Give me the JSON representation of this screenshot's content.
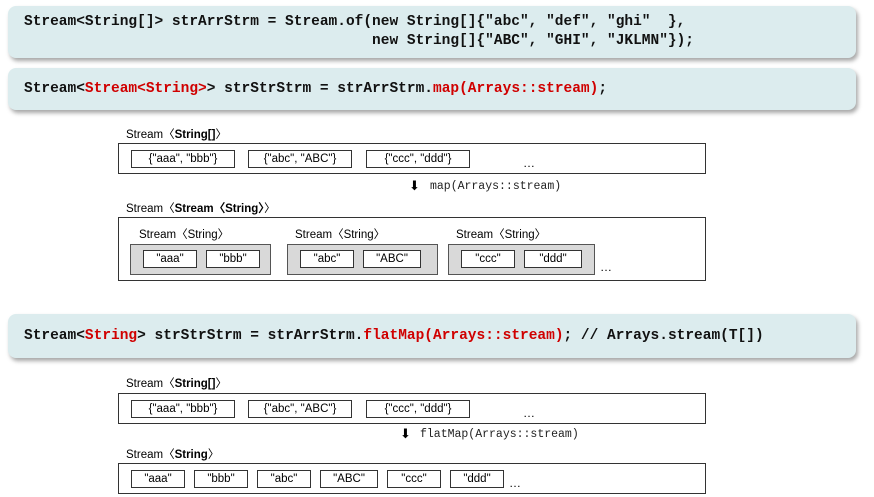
{
  "code1": {
    "line1": "Stream<String[]> strArrStrm = Stream.of(new String[]{\"abc\", \"def\", \"ghi\"  },",
    "line2": "                                        new String[]{\"ABC\", \"GHI\", \"JKLMN\"});"
  },
  "code2": {
    "prefix": "Stream<",
    "t1": "Stream<String>",
    "mid": "> strStrStrm = strArrStrm.",
    "call": "map(Arrays::stream)",
    "end": ";"
  },
  "code3": {
    "prefix": "Stream<",
    "t1": "String",
    "mid": "> strStrStrm = strArrStrm.",
    "call": "flatMap(Arrays::stream)",
    "end": "; // Arrays.stream(T[])"
  },
  "diagram1": {
    "top_label_prefix": "Stream",
    "top_label_type": "String[]",
    "arrays": [
      "{\"aaa\", \"bbb\"}",
      "{\"abc\", \"ABC\"}",
      "{\"ccc\", \"ddd\"}"
    ],
    "ellipsis": "…",
    "operation": "map(Arrays::stream)",
    "bottom_label_prefix": "Stream",
    "bottom_label_type": "Stream",
    "bottom_label_inner": "String",
    "groups": [
      {
        "label": "Stream〈String〉",
        "items": [
          "\"aaa\"",
          "\"bbb\""
        ]
      },
      {
        "label": "Stream〈String〉",
        "items": [
          "\"abc\"",
          "\"ABC\""
        ]
      },
      {
        "label": "Stream〈String〉",
        "items": [
          "\"ccc\"",
          "\"ddd\""
        ]
      }
    ]
  },
  "diagram2": {
    "top_label_prefix": "Stream",
    "top_label_type": "String[]",
    "arrays": [
      "{\"aaa\", \"bbb\"}",
      "{\"abc\", \"ABC\"}",
      "{\"ccc\", \"ddd\"}"
    ],
    "ellipsis": "…",
    "operation": "flatMap(Arrays::stream)",
    "bottom_label_prefix": "Stream",
    "bottom_label_type": "String",
    "items": [
      "\"aaa\"",
      "\"bbb\"",
      "\"abc\"",
      "\"ABC\"",
      "\"ccc\"",
      "\"ddd\""
    ]
  }
}
